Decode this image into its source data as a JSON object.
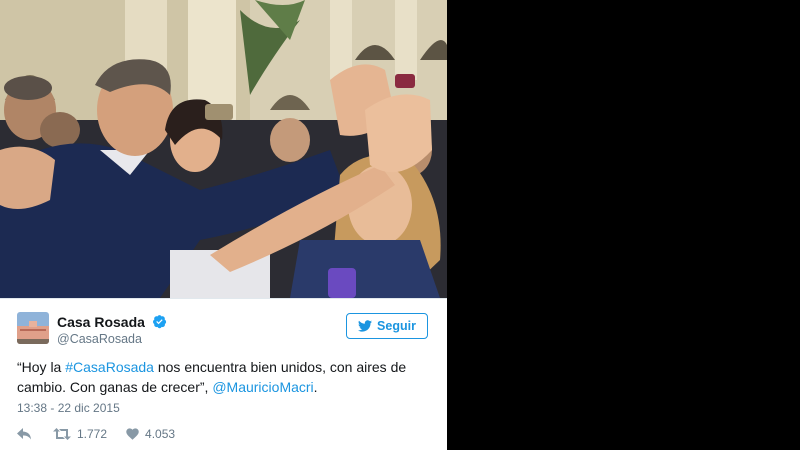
{
  "tweet": {
    "author_name": "Casa Rosada",
    "author_handle": "@CasaRosada",
    "follow_label": "Seguir",
    "text_before": "“Hoy la ",
    "hashtag": "#CasaRosada",
    "text_middle": " nos encuentra bien unidos, con aires de cambio. Con ganas de crecer”, ",
    "mention": "@MauricioMacri",
    "text_after": ".",
    "timestamp": "13:38 - 22 dic 2015",
    "retweet_count": "1.772",
    "like_count": "4.053"
  },
  "colors": {
    "accent": "#1b95e0",
    "text": "#14171a",
    "muted": "#657786",
    "page_background": "#000000"
  },
  "icons": {
    "reply": "reply-icon",
    "retweet": "retweet-icon",
    "like": "heart-icon",
    "verified": "verified-badge-icon",
    "follow": "twitter-bird-icon"
  }
}
